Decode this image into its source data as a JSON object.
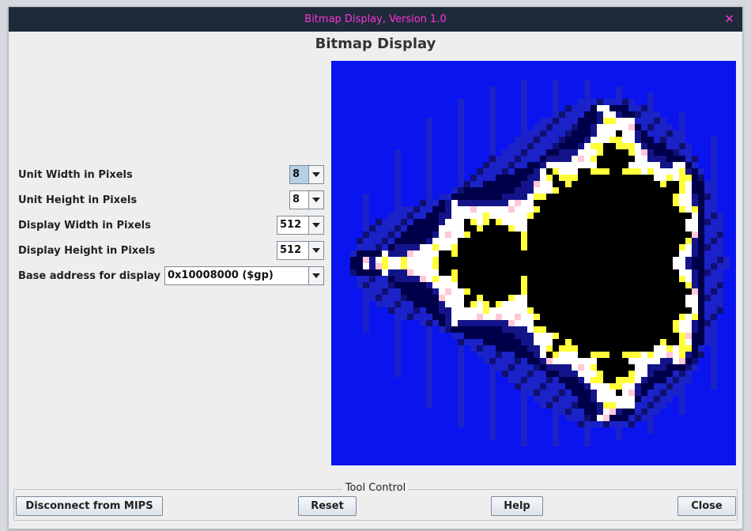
{
  "window": {
    "title": "Bitmap Display, Version 1.0",
    "heading": "Bitmap Display"
  },
  "settings": [
    {
      "label": "Unit Width in Pixels",
      "value": "8"
    },
    {
      "label": "Unit Height in Pixels",
      "value": "8"
    },
    {
      "label": "Display Width in Pixels",
      "value": "512"
    },
    {
      "label": "Display Height in Pixels",
      "value": "512"
    },
    {
      "label": "Base address for display",
      "value": "0x10008000 ($gp)"
    }
  ],
  "display": {
    "content": "mandelbrot-set",
    "colors": {
      "background": "#0a14ee",
      "set": "#000000",
      "edge_white": "#ffffff",
      "edge_yellow": "#ffff3a",
      "edge_pink": "#ffc8d8",
      "dark_blue": "#00004a"
    }
  },
  "tool_control": {
    "legend": "Tool Control",
    "disconnect_label": "Disconnect from MIPS",
    "reset_label": "Reset",
    "help_label": "Help",
    "close_label": "Close"
  }
}
